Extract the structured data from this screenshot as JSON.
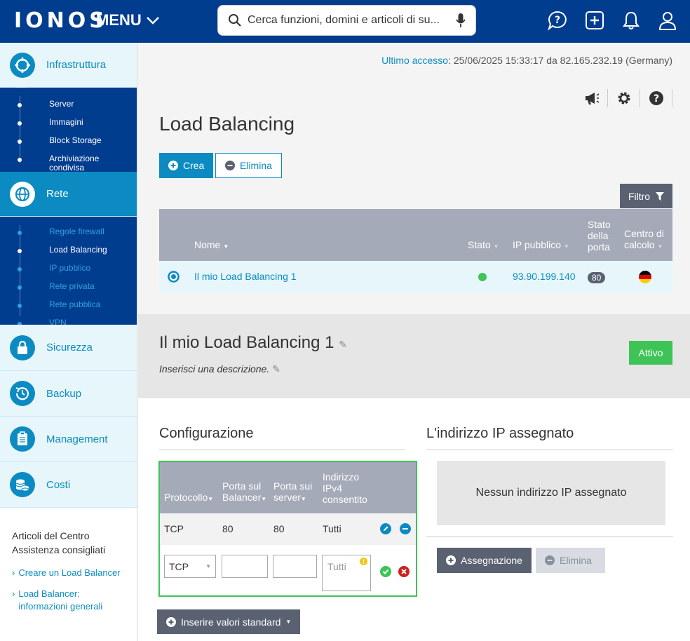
{
  "brand": {
    "logo": "IONOS",
    "menu_label": "MENU"
  },
  "search": {
    "placeholder": "Cerca funzioni, domini e articoli di su..."
  },
  "sidebar": {
    "infra": {
      "label": "Infrastruttura",
      "items": [
        "Server",
        "Immagini",
        "Block Storage",
        "Archiviazione condivisa"
      ]
    },
    "rete": {
      "label": "Rete",
      "items": [
        "Regole firewall",
        "Load Balancing",
        "IP pubblico",
        "Rete privata",
        "Rete pubblica",
        "VPN"
      ]
    },
    "sicurezza": "Sicurezza",
    "backup": "Backup",
    "management": "Management",
    "costi": "Costi",
    "help_title": "Articoli del Centro Assistenza consigliati",
    "help_links": [
      "Creare un Load Balancer",
      "Load Balancer: informazioni generali"
    ]
  },
  "header": {
    "last_access_key": "Ultimo accesso",
    "last_access_value": ": 25/06/2025 15:33:17 da 82.165.232.19 (Germany)"
  },
  "page": {
    "title": "Load Balancing",
    "create": "Crea",
    "delete": "Elimina",
    "filter": "Filtro"
  },
  "table": {
    "headers": {
      "name": "Nome",
      "state": "Stato",
      "ip": "IP pubblico",
      "port_state": "Stato della porta",
      "dc": "Centro di calcolo"
    },
    "row": {
      "name": "Il mio Load Balancing 1",
      "ip": "93.90.199.140",
      "port": "80"
    }
  },
  "detail": {
    "title": "Il mio Load Balancing 1",
    "description": "Inserisci una descrizione.",
    "status": "Attivo"
  },
  "config": {
    "title": "Configurazione",
    "headers": {
      "protocol": "Protocollo",
      "balancer_port": "Porta sul Balancer",
      "server_port": "Porta sui server",
      "ipv4": "Indirizzo IPv4 consentito"
    },
    "row": {
      "protocol": "TCP",
      "balancer_port": "80",
      "server_port": "80",
      "ipv4": "Tutti"
    },
    "new_row": {
      "protocol": "TCP",
      "ipv4_placeholder": "Tutti"
    },
    "defaults_button": "Inserire valori standard"
  },
  "ip": {
    "title": "L'indirizzo IP assegnato",
    "empty": "Nessun indirizzo IP assegnato",
    "assign": "Assegnazione",
    "delete": "Elimina"
  },
  "colors": {
    "navy": "#003d8f",
    "blue": "#0b8bc2",
    "green": "#3ec456",
    "gray_header": "#a4aab8"
  }
}
